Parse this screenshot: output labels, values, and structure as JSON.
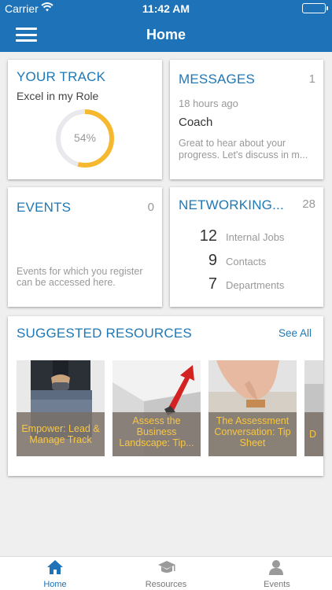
{
  "status_bar": {
    "carrier": "Carrier",
    "time": "11:42 AM"
  },
  "header": {
    "title": "Home"
  },
  "track": {
    "title": "YOUR TRACK",
    "subtitle": "Excel in my Role",
    "progress_label": "54%",
    "progress": 0.54,
    "ring_color": "#f5b82e"
  },
  "messages": {
    "title": "MESSAGES",
    "count": "1",
    "time_ago": "18 hours ago",
    "sender": "Coach",
    "preview": "Great to hear about your progress. Let's discuss in m..."
  },
  "events": {
    "title": "EVENTS",
    "count": "0",
    "description": "Events for which you register can be accessed here."
  },
  "networking": {
    "title": "NETWORKING...",
    "count": "28",
    "rows": [
      {
        "value": "12",
        "label": "Internal Jobs"
      },
      {
        "value": "9",
        "label": "Contacts"
      },
      {
        "value": "7",
        "label": "Departments"
      }
    ]
  },
  "resources": {
    "title": "SUGGESTED RESOURCES",
    "see_all": "See All",
    "items": [
      {
        "title": "Empower: Lead & Manage Track"
      },
      {
        "title": "Assess the Business Landscape: Tip..."
      },
      {
        "title": "The Assessment Conversation: Tip Sheet"
      },
      {
        "title": "D"
      }
    ]
  },
  "tabs": [
    {
      "label": "Home",
      "icon": "home-icon",
      "active": true
    },
    {
      "label": "Resources",
      "icon": "graduation-cap-icon",
      "active": false
    },
    {
      "label": "Events",
      "icon": "person-icon",
      "active": false
    }
  ],
  "colors": {
    "brand_blue": "#1e73b8",
    "accent_yellow": "#f5b82e",
    "caption_text": "#f8c644"
  }
}
